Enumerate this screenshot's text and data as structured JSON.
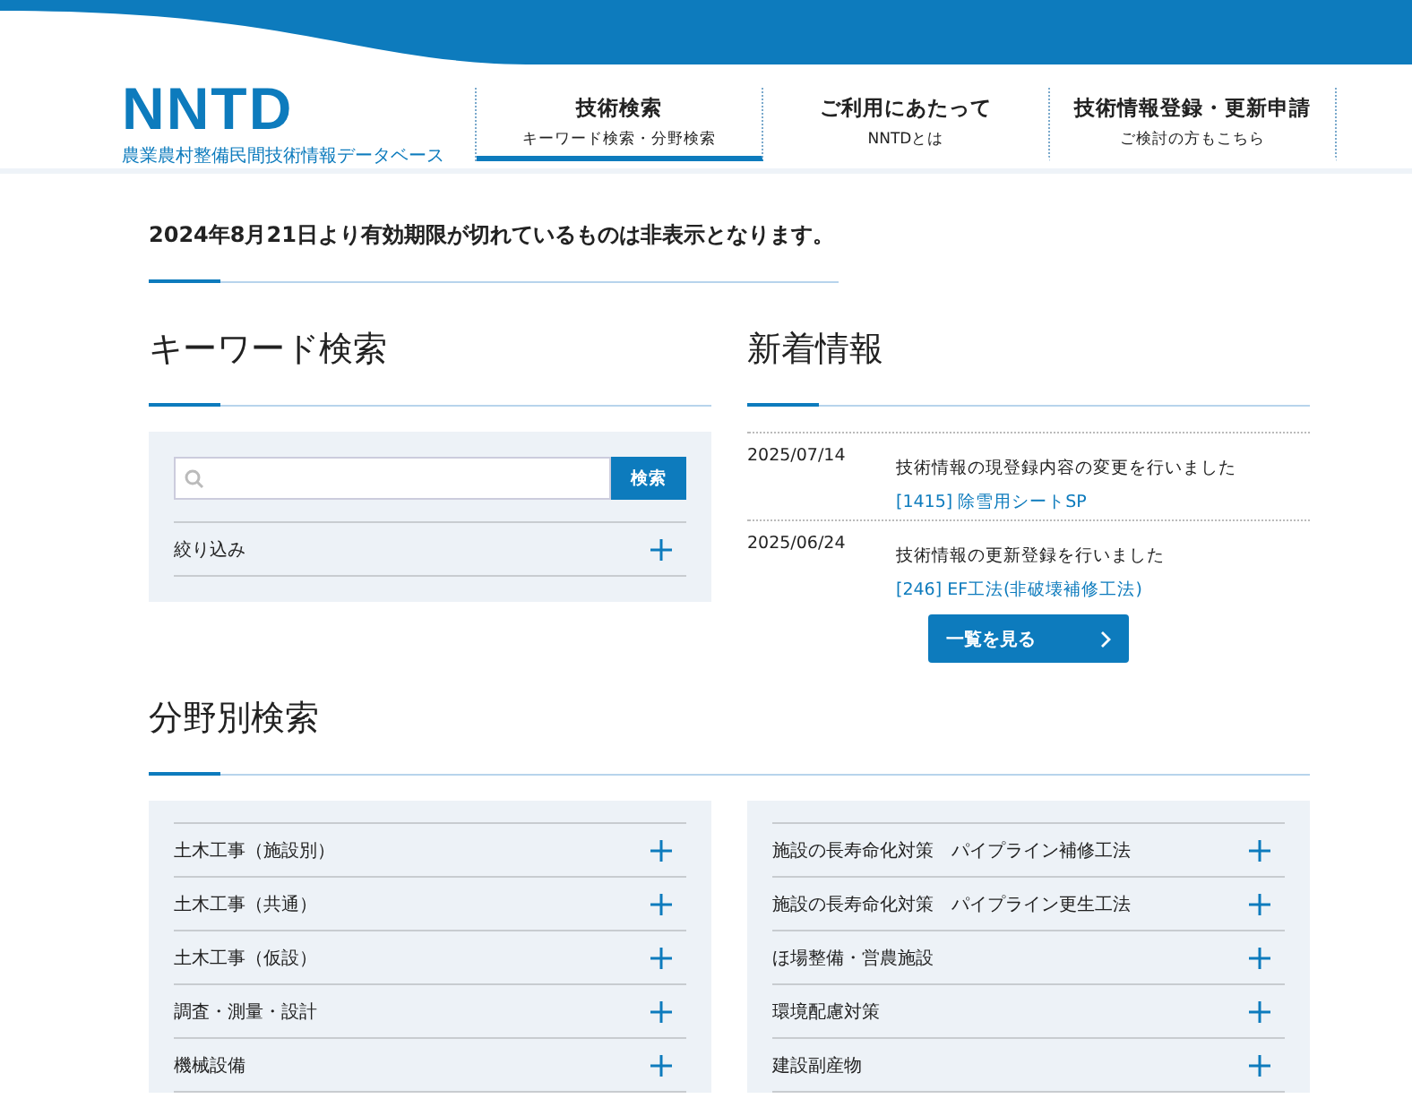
{
  "header": {
    "logo": "NNTD",
    "logo_subtitle": "農業農村整備民間技術情報データベース",
    "nav": [
      {
        "label": "技術検索",
        "sublabel": "キーワード検索・分野検索",
        "selected": true
      },
      {
        "label": "ご利用にあたって",
        "sublabel": "NNTDとは",
        "selected": false
      },
      {
        "label": "技術情報登録・更新申請",
        "sublabel": "ご検討の方もこちら",
        "selected": false
      }
    ]
  },
  "notice": "2024年8月21日より有効期限が切れているものは非表示となります。",
  "keyword_search": {
    "title": "キーワード検索",
    "search_button": "検索",
    "filter": {
      "label": "絞り込み",
      "expanded": false
    }
  },
  "news": {
    "title": "新着情報",
    "items": [
      {
        "date": "2025/07/14",
        "text": "技術情報の現登録内容の変更を行いました",
        "link": "[1415] 除雪用シートSP"
      },
      {
        "date": "2025/06/24",
        "text": "技術情報の更新登録を行いました",
        "link": "[246] EF工法(非破壊補修工法)"
      }
    ],
    "more_button": "一覧を見る"
  },
  "field_search": {
    "title": "分野別検索",
    "columns": [
      [
        {
          "label": "土木工事（施設別）",
          "expanded": false
        },
        {
          "label": "土木工事（共通）",
          "expanded": false
        },
        {
          "label": "土木工事（仮設）",
          "expanded": false
        },
        {
          "label": "調査・測量・設計",
          "expanded": false
        },
        {
          "label": "機械設備",
          "expanded": false
        }
      ],
      [
        {
          "label": "施設の長寿命化対策　パイプライン補修工法",
          "expanded": false
        },
        {
          "label": "施設の長寿命化対策　パイプライン更生工法",
          "expanded": false
        },
        {
          "label": "ほ場整備・営農施設",
          "expanded": false
        },
        {
          "label": "環境配慮対策",
          "expanded": false
        },
        {
          "label": "建設副産物",
          "expanded": false
        }
      ]
    ]
  }
}
